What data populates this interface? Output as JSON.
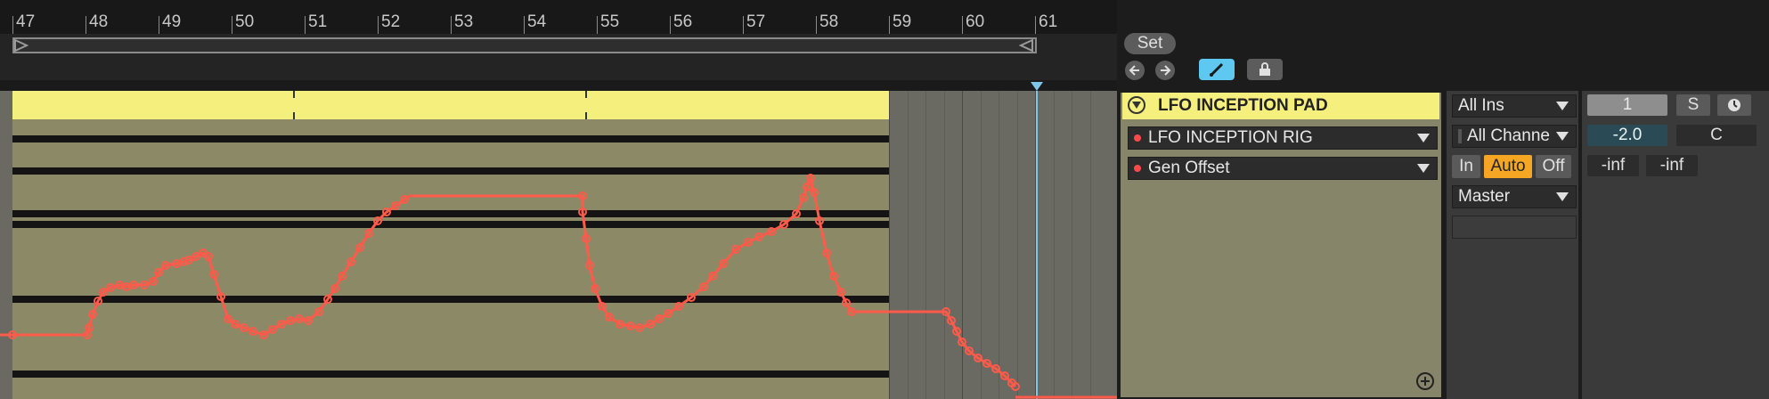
{
  "ruler": {
    "bars": [
      "47",
      "48",
      "49",
      "50",
      "51",
      "52",
      "53",
      "54",
      "55",
      "56",
      "57",
      "58",
      "59",
      "60",
      "61"
    ]
  },
  "arrangement": {
    "automation_color": "#ff5a4a",
    "clip_color": "#f5f07e"
  },
  "loop": {
    "set_label": "Set"
  },
  "nav": {
    "prev_icon": "arrow-left-icon",
    "next_icon": "arrow-right-icon",
    "draw_icon": "draw-mode-icon",
    "lock_icon": "lock-icon"
  },
  "track": {
    "name": "LFO INCEPTION PAD",
    "device": "LFO INCEPTION RIG",
    "parameter": "Gen Offset"
  },
  "io": {
    "input_type": "All Ins",
    "input_channel": "All Channe",
    "monitor": {
      "in": "In",
      "auto": "Auto",
      "off": "Off",
      "active": "Auto"
    },
    "output": "Master"
  },
  "mixer": {
    "track_number": "1",
    "solo": "S",
    "volume": "-2.0",
    "pan": "C",
    "peak_left": "-inf",
    "peak_right": "-inf"
  }
}
